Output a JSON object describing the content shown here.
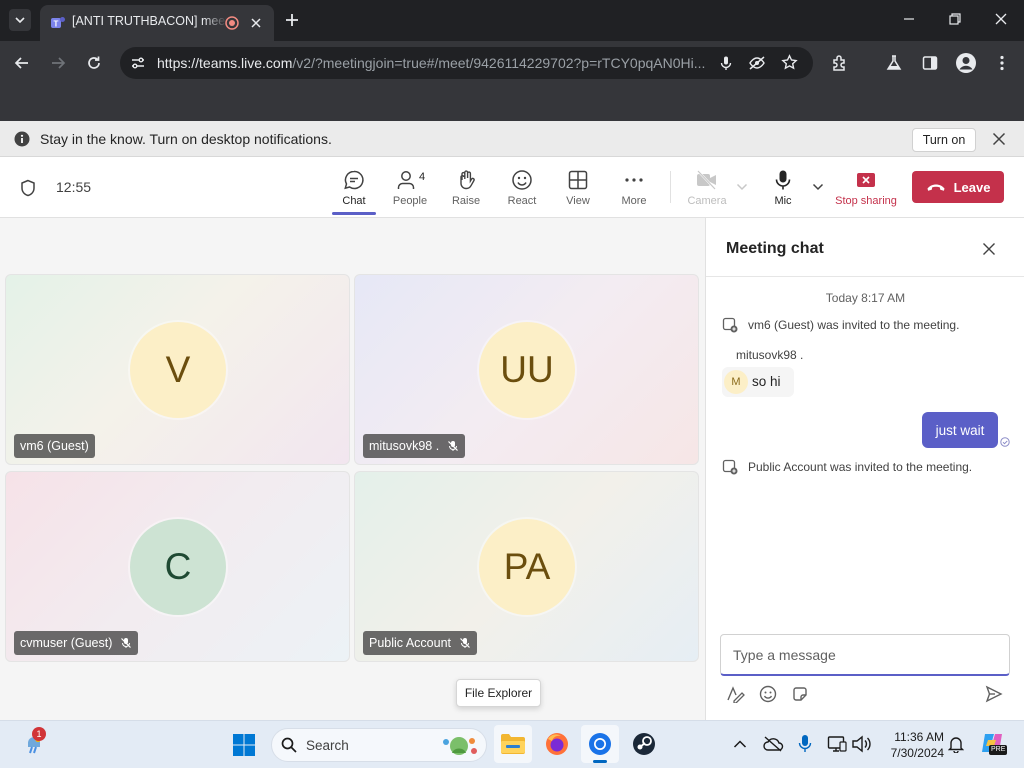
{
  "browser": {
    "tab_title": "[ANTI TRUTHBACON] meeting",
    "url_host": "https://teams.live.com",
    "url_path": "/v2/?meetingjoin=true#/meet/9426114229702?p=rTCY0pqAN0Hi..."
  },
  "notification": {
    "text": "Stay in the know. Turn on desktop notifications.",
    "button_label": "Turn on"
  },
  "meeting": {
    "elapsed": "12:55",
    "people_count": "4",
    "toolbar": {
      "chat": "Chat",
      "people": "People",
      "raise": "Raise",
      "react": "React",
      "view": "View",
      "more": "More",
      "camera": "Camera",
      "mic": "Mic",
      "stop_sharing": "Stop sharing",
      "leave": "Leave"
    },
    "participants": [
      {
        "initials": "V",
        "name": "vm6 (Guest)",
        "muted": false
      },
      {
        "initials": "UU",
        "name": "mitusovk98 .",
        "muted": true
      },
      {
        "initials": "C",
        "name": "cvmuser (Guest)",
        "muted": true
      },
      {
        "initials": "PA",
        "name": "Public Account",
        "muted": true
      }
    ]
  },
  "tooltip": {
    "text": "File Explorer"
  },
  "chat": {
    "title": "Meeting chat",
    "date_divider": "Today 8:17 AM",
    "messages": {
      "sys1": "vm6 (Guest) was invited to the meeting.",
      "sender": "mitusovk98 .",
      "sender_initial": "M",
      "incoming": "so hi",
      "outgoing": "just wait",
      "sys2": "Public Account was invited to the meeting."
    },
    "input_placeholder": "Type a message"
  },
  "taskbar": {
    "search_label": "Search",
    "time": "11:36 AM",
    "date": "7/30/2024",
    "weather_badge": "1",
    "copilot_badge": "PRE"
  },
  "colors": {
    "teams_purple": "#5b5fc7",
    "leave_red": "#c4314b",
    "stop_share_red": "#c4314b",
    "bubble_self": "#5b5fc7"
  }
}
